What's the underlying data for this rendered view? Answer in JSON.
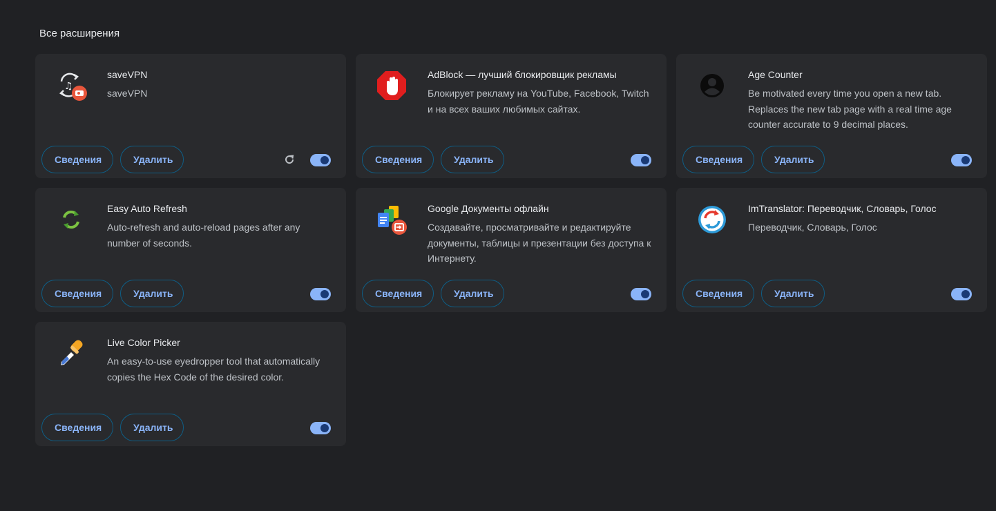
{
  "section": {
    "title": "Все расширения"
  },
  "buttons": {
    "details_label": "Сведения",
    "remove_label": "Удалить"
  },
  "extensions": [
    {
      "name": "saveVPN",
      "description": "saveVPN",
      "icon": "savevpn-icon",
      "enabled": true,
      "has_reload": true
    },
    {
      "name": "AdBlock — лучший блокировщик рекламы",
      "description": "Блокирует рекламу на YouTube, Facebook, Twitch и на всех ваших любимых сайтах.",
      "icon": "adblock-stop-hand-icon",
      "enabled": true
    },
    {
      "name": "Age Counter",
      "description": "Be motivated every time you open a new tab. Replaces the new tab page with a real time age counter accurate to 9 decimal places.",
      "icon": "person-avatar-icon",
      "enabled": true
    },
    {
      "name": "Easy Auto Refresh",
      "description": "Auto-refresh and auto-reload pages after any number of seconds.",
      "icon": "refresh-arrows-icon",
      "enabled": true
    },
    {
      "name": "Google Документы офлайн",
      "description": "Создавайте, просматривайте и редактируйте документы, таблицы и презентации без доступа к Интернету.",
      "icon": "google-docs-offline-icon",
      "enabled": true
    },
    {
      "name": "ImTranslator: Переводчик, Словарь, Голос",
      "description": "Переводчик, Словарь, Голос",
      "icon": "imtranslator-icon",
      "enabled": true
    },
    {
      "name": "Live Color Picker",
      "description": "An easy-to-use eyedropper tool that automatically copies the Hex Code of the desired color.",
      "icon": "eyedropper-icon",
      "enabled": true
    }
  ],
  "colors": {
    "page_bg": "#202124",
    "card_bg": "#292a2d",
    "accent": "#8ab4f8",
    "button_border": "#0e5e86"
  }
}
